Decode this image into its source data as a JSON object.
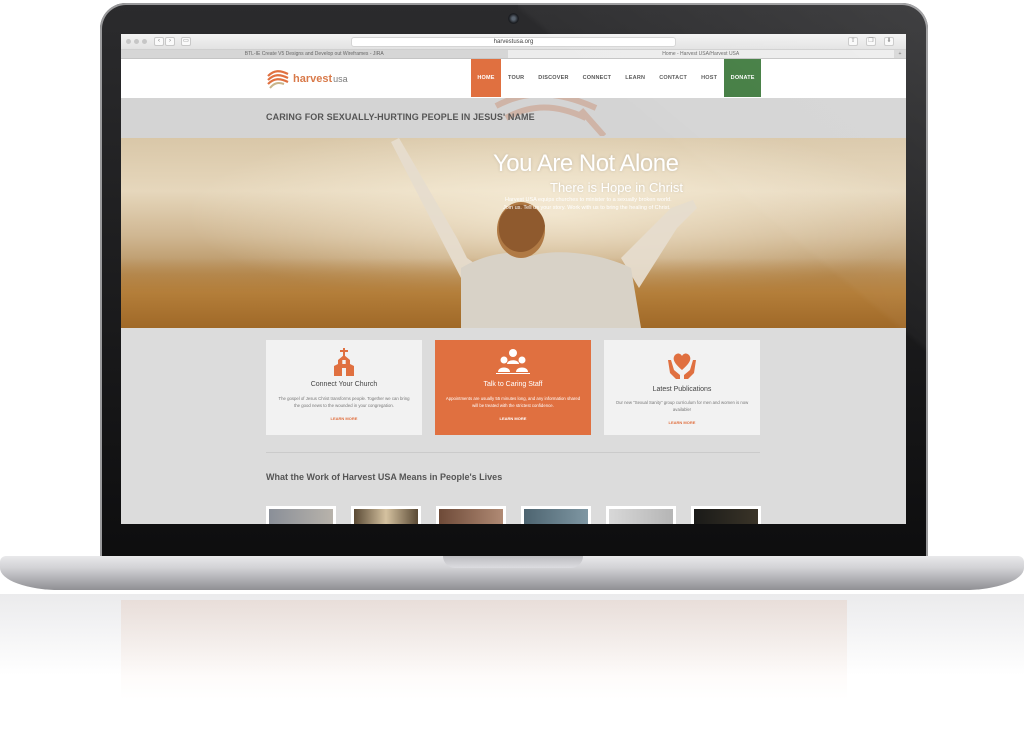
{
  "browser": {
    "url": "harvestusa.org",
    "tabs": [
      {
        "label": "BTL-IE Create V5 Designs and Develop out Wireframes - JIRA"
      },
      {
        "label": "Home - Harvest USA/Harvest USA"
      }
    ]
  },
  "site": {
    "logo": {
      "name": "harvest",
      "suffix": "usa"
    },
    "nav": [
      {
        "label": "HOME"
      },
      {
        "label": "TOUR"
      },
      {
        "label": "DISCOVER"
      },
      {
        "label": "CONNECT"
      },
      {
        "label": "LEARN"
      },
      {
        "label": "CONTACT"
      },
      {
        "label": "HOST"
      },
      {
        "label": "DONATE"
      }
    ],
    "tagline": "CARING FOR SEXUALLY-HURTING PEOPLE IN JESUS' NAME",
    "hero": {
      "title": "You Are Not Alone",
      "subtitle": "There is Hope in Christ",
      "copy_line1": "Harvest USA equips churches to minister to a sexually broken world.",
      "copy_line2": "Join us. Tell us your story. Work with us to bring the healing of Christ."
    },
    "cards": [
      {
        "icon": "church-icon",
        "title": "Connect Your Church",
        "text": "The gospel of Jesus Christ transforms people. Together we can bring the good news to the wounded in your congregation.",
        "link": "LEARN MORE"
      },
      {
        "icon": "people-icon",
        "title": "Talk to Caring Staff",
        "text": "Appointments are usually 55 minutes long, and any information shared will be treated with the strictest confidence.",
        "link": "LEARN MORE"
      },
      {
        "icon": "heart-hands-icon",
        "title": "Latest Publications",
        "text": "Our new \"Sexual Sanity\" group curriculum for men and women is now available!",
        "link": "LEARN MORE"
      }
    ],
    "section_title": "What the Work of Harvest USA Means in People's Lives"
  },
  "colors": {
    "accent": "#e07040",
    "donate": "#3f7a3e",
    "band": "#d4d4d4"
  }
}
